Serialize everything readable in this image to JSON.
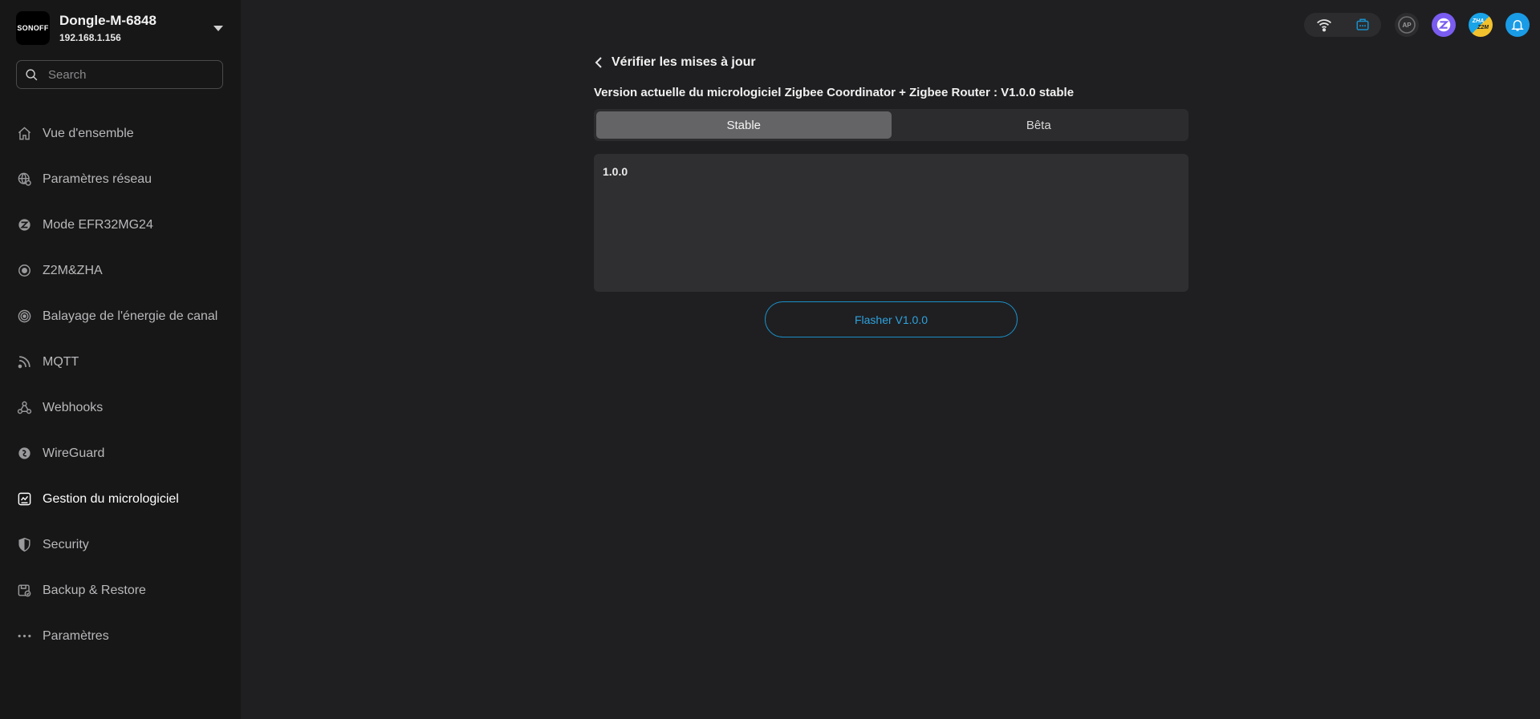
{
  "device": {
    "logo_text": "SONOFF",
    "name": "Dongle-M-6848",
    "ip": "192.168.1.156"
  },
  "search": {
    "placeholder": "Search"
  },
  "sidebar": {
    "items": [
      {
        "label": "Vue d'ensemble",
        "icon": "home-icon"
      },
      {
        "label": "Paramètres réseau",
        "icon": "globe-gear-icon"
      },
      {
        "label": "Mode EFR32MG24",
        "icon": "zigbee-icon"
      },
      {
        "label": "Z2M&ZHA",
        "icon": "target-icon"
      },
      {
        "label": "Balayage de l'énergie de canal",
        "icon": "radar-icon"
      },
      {
        "label": "MQTT",
        "icon": "rss-icon"
      },
      {
        "label": "Webhooks",
        "icon": "webhook-icon"
      },
      {
        "label": "WireGuard",
        "icon": "wireguard-icon"
      },
      {
        "label": "Gestion du micrologiciel",
        "icon": "firmware-icon",
        "active": true
      },
      {
        "label": "Security",
        "icon": "shield-icon"
      },
      {
        "label": "Backup & Restore",
        "icon": "backup-icon"
      },
      {
        "label": "Paramètres",
        "icon": "more-dots-icon"
      }
    ]
  },
  "topbar": {
    "ap_label": "AP",
    "zha_label": "ZHA",
    "z2m_label": "Z2M",
    "accent": "#1a8fc9"
  },
  "main": {
    "back_label": "Vérifier les mises à jour",
    "current_version_text": "Version actuelle du micrologiciel Zigbee Coordinator + Zigbee Router : V1.0.0 stable",
    "tabs": [
      {
        "label": "Stable",
        "active": true
      },
      {
        "label": "Bêta",
        "active": false
      }
    ],
    "release_notes": "1.0.0",
    "flash_button": "Flasher V1.0.0"
  }
}
